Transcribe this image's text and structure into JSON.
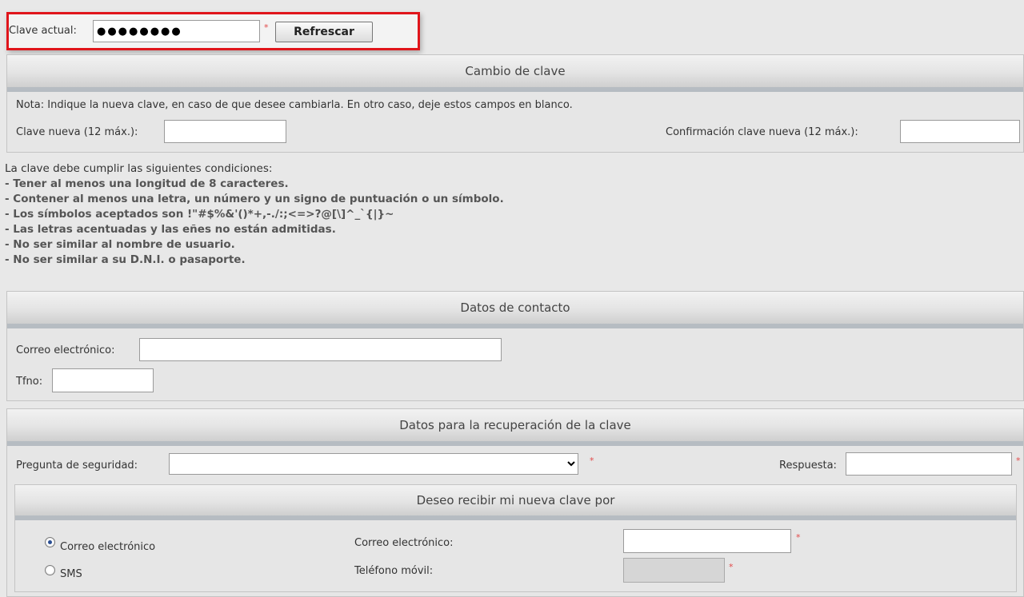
{
  "top": {
    "current_password_label": "Clave actual:",
    "current_password_value": "●●●●●●●●",
    "required_mark": "*",
    "refresh_button": "Refrescar"
  },
  "change_password": {
    "title": "Cambio de clave",
    "note": "Nota:  Indique la nueva clave, en caso de que desee cambiarla. En otro caso, deje estos campos en blanco.",
    "new_password_label": "Clave nueva (12 máx.):",
    "confirm_password_label": "Confirmación clave nueva (12 máx.):"
  },
  "rules": {
    "intro": "La clave debe cumplir las siguientes condiciones:",
    "items": [
      "- Tener al menos una longitud de 8 caracteres.",
      "- Contener al menos una letra, un número y un signo de puntuación o un símbolo.",
      "- Los símbolos aceptados son !\"#$%&'()*+,-./:;<=>?@[\\]^_`{|}~",
      "- Las letras acentuadas y las eñes no están admitidas.",
      "- No ser similar al nombre de usuario.",
      "- No ser similar a su D.N.I. o pasaporte."
    ]
  },
  "contact": {
    "title": "Datos de contacto",
    "email_label": "Correo electrónico:",
    "phone_label": "Tfno:"
  },
  "recovery": {
    "title": "Datos para la recuperación de la clave",
    "question_label": "Pregunta de seguridad:",
    "question_selected": "",
    "answer_label": "Respuesta:",
    "delivery": {
      "title": "Deseo recibir mi nueva clave por",
      "option_email": "Correo electrónico",
      "option_sms": "SMS",
      "email_label": "Correo electrónico:",
      "mobile_label": "Teléfono móvil:",
      "selected": "email"
    }
  },
  "colors": {
    "highlight_border": "#e0151b",
    "required_asterisk": "#e24a4a"
  }
}
